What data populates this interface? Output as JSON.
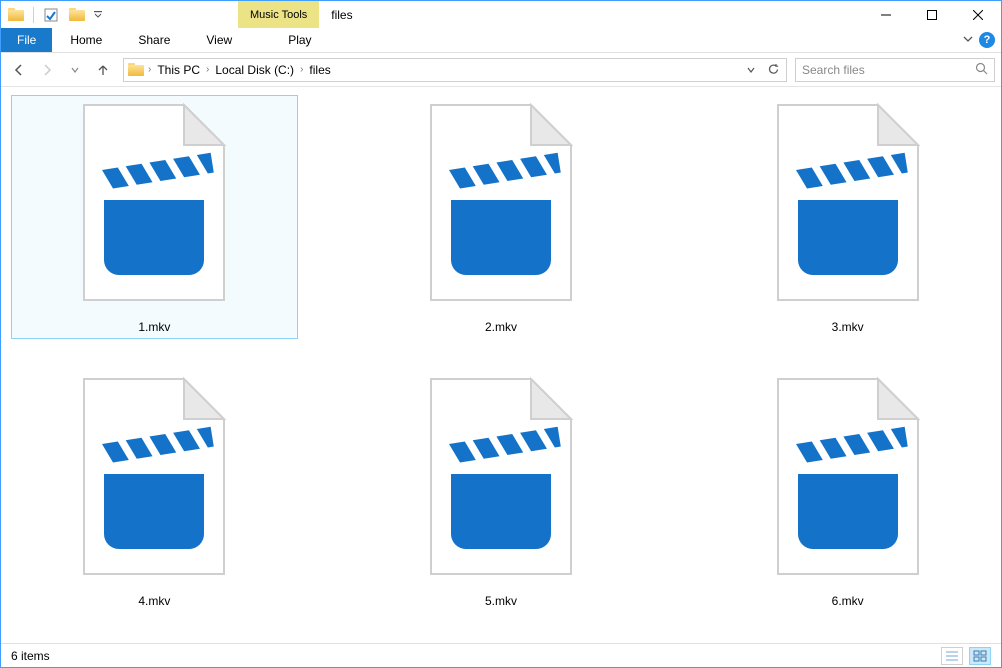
{
  "titlebar": {
    "context_tab": "Music Tools",
    "window_title": "files"
  },
  "ribbon": {
    "file": "File",
    "tabs": [
      "Home",
      "Share",
      "View"
    ],
    "context_tabs": [
      "Play"
    ]
  },
  "breadcrumbs": [
    "This PC",
    "Local Disk (C:)",
    "files"
  ],
  "search": {
    "placeholder": "Search files"
  },
  "files": [
    {
      "name": "1.mkv",
      "selected": true
    },
    {
      "name": "2.mkv",
      "selected": false
    },
    {
      "name": "3.mkv",
      "selected": false
    },
    {
      "name": "4.mkv",
      "selected": false
    },
    {
      "name": "5.mkv",
      "selected": false
    },
    {
      "name": "6.mkv",
      "selected": false
    }
  ],
  "status": {
    "count_text": "6 items"
  }
}
